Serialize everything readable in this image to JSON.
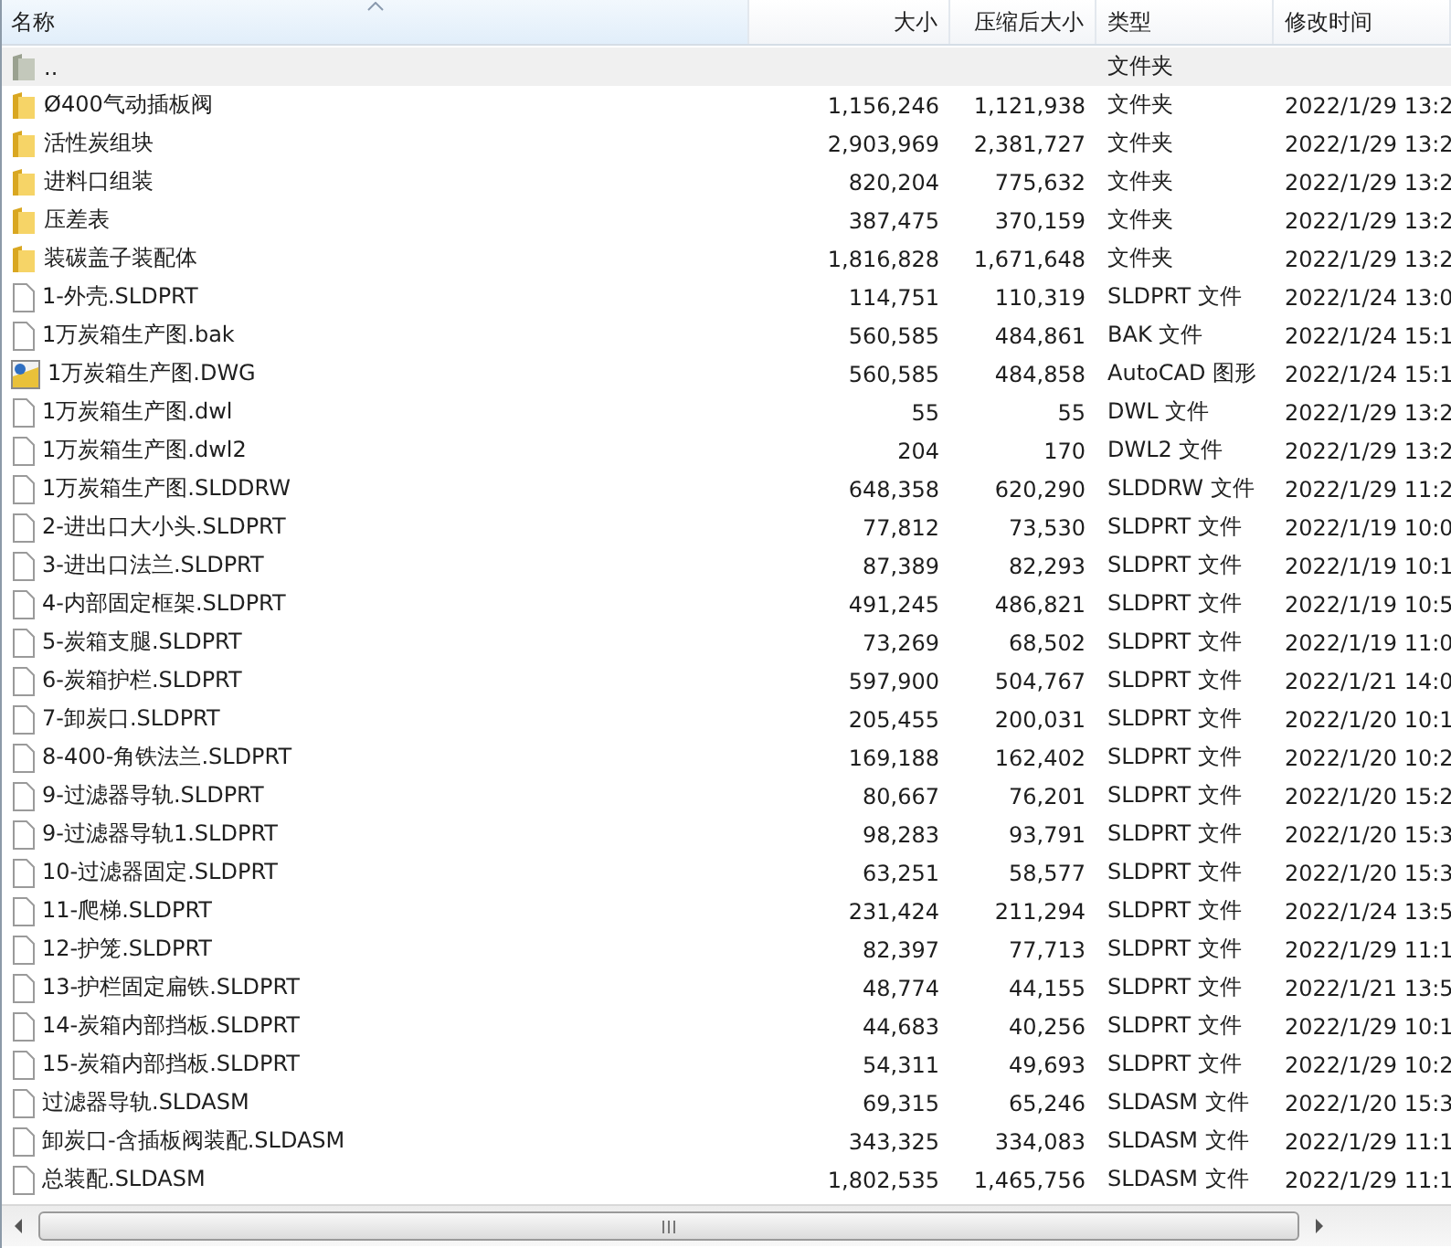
{
  "columns": [
    {
      "label": "名称",
      "sorted": true
    },
    {
      "label": "大小",
      "sorted": false
    },
    {
      "label": "压缩后大小",
      "sorted": false
    },
    {
      "label": "类型",
      "sorted": false
    },
    {
      "label": "修改时间",
      "sorted": false
    }
  ],
  "rows": [
    {
      "kind": "parent",
      "name": "..",
      "size": "",
      "packed": "",
      "type": "文件夹",
      "modified": "",
      "selected": true
    },
    {
      "kind": "folder",
      "name": "Ø400气动插板阀",
      "size": "1,156,246",
      "packed": "1,121,938",
      "type": "文件夹",
      "modified": "2022/1/29 13:2",
      "selected": false
    },
    {
      "kind": "folder",
      "name": "活性炭组块",
      "size": "2,903,969",
      "packed": "2,381,727",
      "type": "文件夹",
      "modified": "2022/1/29 13:2",
      "selected": false
    },
    {
      "kind": "folder",
      "name": "进料口组装",
      "size": "820,204",
      "packed": "775,632",
      "type": "文件夹",
      "modified": "2022/1/29 13:2",
      "selected": false
    },
    {
      "kind": "folder",
      "name": "压差表",
      "size": "387,475",
      "packed": "370,159",
      "type": "文件夹",
      "modified": "2022/1/29 13:2",
      "selected": false
    },
    {
      "kind": "folder",
      "name": "装碳盖子装配体",
      "size": "1,816,828",
      "packed": "1,671,648",
      "type": "文件夹",
      "modified": "2022/1/29 13:2",
      "selected": false
    },
    {
      "kind": "file",
      "name": "1-外壳.SLDPRT",
      "size": "114,751",
      "packed": "110,319",
      "type": "SLDPRT 文件",
      "modified": "2022/1/24 13:0",
      "selected": false
    },
    {
      "kind": "file",
      "name": "1万炭箱生产图.bak",
      "size": "560,585",
      "packed": "484,861",
      "type": "BAK 文件",
      "modified": "2022/1/24 15:1",
      "selected": false
    },
    {
      "kind": "cad",
      "name": "1万炭箱生产图.DWG",
      "size": "560,585",
      "packed": "484,858",
      "type": "AutoCAD 图形",
      "modified": "2022/1/24 15:1",
      "selected": false
    },
    {
      "kind": "file",
      "name": "1万炭箱生产图.dwl",
      "size": "55",
      "packed": "55",
      "type": "DWL 文件",
      "modified": "2022/1/29 13:2",
      "selected": false
    },
    {
      "kind": "file",
      "name": "1万炭箱生产图.dwl2",
      "size": "204",
      "packed": "170",
      "type": "DWL2 文件",
      "modified": "2022/1/29 13:2",
      "selected": false
    },
    {
      "kind": "file",
      "name": "1万炭箱生产图.SLDDRW",
      "size": "648,358",
      "packed": "620,290",
      "type": "SLDDRW 文件",
      "modified": "2022/1/29 11:2",
      "selected": false
    },
    {
      "kind": "file",
      "name": "2-进出口大小头.SLDPRT",
      "size": "77,812",
      "packed": "73,530",
      "type": "SLDPRT 文件",
      "modified": "2022/1/19 10:0",
      "selected": false
    },
    {
      "kind": "file",
      "name": "3-进出口法兰.SLDPRT",
      "size": "87,389",
      "packed": "82,293",
      "type": "SLDPRT 文件",
      "modified": "2022/1/19 10:1",
      "selected": false
    },
    {
      "kind": "file",
      "name": "4-内部固定框架.SLDPRT",
      "size": "491,245",
      "packed": "486,821",
      "type": "SLDPRT 文件",
      "modified": "2022/1/19 10:5",
      "selected": false
    },
    {
      "kind": "file",
      "name": "5-炭箱支腿.SLDPRT",
      "size": "73,269",
      "packed": "68,502",
      "type": "SLDPRT 文件",
      "modified": "2022/1/19 11:0",
      "selected": false
    },
    {
      "kind": "file",
      "name": "6-炭箱护栏.SLDPRT",
      "size": "597,900",
      "packed": "504,767",
      "type": "SLDPRT 文件",
      "modified": "2022/1/21 14:0",
      "selected": false
    },
    {
      "kind": "file",
      "name": "7-卸炭口.SLDPRT",
      "size": "205,455",
      "packed": "200,031",
      "type": "SLDPRT 文件",
      "modified": "2022/1/20 10:1",
      "selected": false
    },
    {
      "kind": "file",
      "name": "8-400-角铁法兰.SLDPRT",
      "size": "169,188",
      "packed": "162,402",
      "type": "SLDPRT 文件",
      "modified": "2022/1/20 10:2",
      "selected": false
    },
    {
      "kind": "file",
      "name": "9-过滤器导轨.SLDPRT",
      "size": "80,667",
      "packed": "76,201",
      "type": "SLDPRT 文件",
      "modified": "2022/1/20 15:2",
      "selected": false
    },
    {
      "kind": "file",
      "name": "9-过滤器导轨1.SLDPRT",
      "size": "98,283",
      "packed": "93,791",
      "type": "SLDPRT 文件",
      "modified": "2022/1/20 15:3",
      "selected": false
    },
    {
      "kind": "file",
      "name": "10-过滤器固定.SLDPRT",
      "size": "63,251",
      "packed": "58,577",
      "type": "SLDPRT 文件",
      "modified": "2022/1/20 15:3",
      "selected": false
    },
    {
      "kind": "file",
      "name": "11-爬梯.SLDPRT",
      "size": "231,424",
      "packed": "211,294",
      "type": "SLDPRT 文件",
      "modified": "2022/1/24 13:5",
      "selected": false
    },
    {
      "kind": "file",
      "name": "12-护笼.SLDPRT",
      "size": "82,397",
      "packed": "77,713",
      "type": "SLDPRT 文件",
      "modified": "2022/1/29 11:1",
      "selected": false
    },
    {
      "kind": "file",
      "name": "13-护栏固定扁铁.SLDPRT",
      "size": "48,774",
      "packed": "44,155",
      "type": "SLDPRT 文件",
      "modified": "2022/1/21 13:5",
      "selected": false
    },
    {
      "kind": "file",
      "name": "14-炭箱内部挡板.SLDPRT",
      "size": "44,683",
      "packed": "40,256",
      "type": "SLDPRT 文件",
      "modified": "2022/1/29 10:1",
      "selected": false
    },
    {
      "kind": "file",
      "name": "15-炭箱内部挡板.SLDPRT",
      "size": "54,311",
      "packed": "49,693",
      "type": "SLDPRT 文件",
      "modified": "2022/1/29 10:2",
      "selected": false
    },
    {
      "kind": "file",
      "name": "过滤器导轨.SLDASM",
      "size": "69,315",
      "packed": "65,246",
      "type": "SLDASM 文件",
      "modified": "2022/1/20 15:3",
      "selected": false
    },
    {
      "kind": "file",
      "name": "卸炭口-含插板阀装配.SLDASM",
      "size": "343,325",
      "packed": "334,083",
      "type": "SLDASM 文件",
      "modified": "2022/1/29 11:1",
      "selected": false
    },
    {
      "kind": "file",
      "name": "总装配.SLDASM",
      "size": "1,802,535",
      "packed": "1,465,756",
      "type": "SLDASM 文件",
      "modified": "2022/1/29 11:1",
      "selected": false
    }
  ]
}
